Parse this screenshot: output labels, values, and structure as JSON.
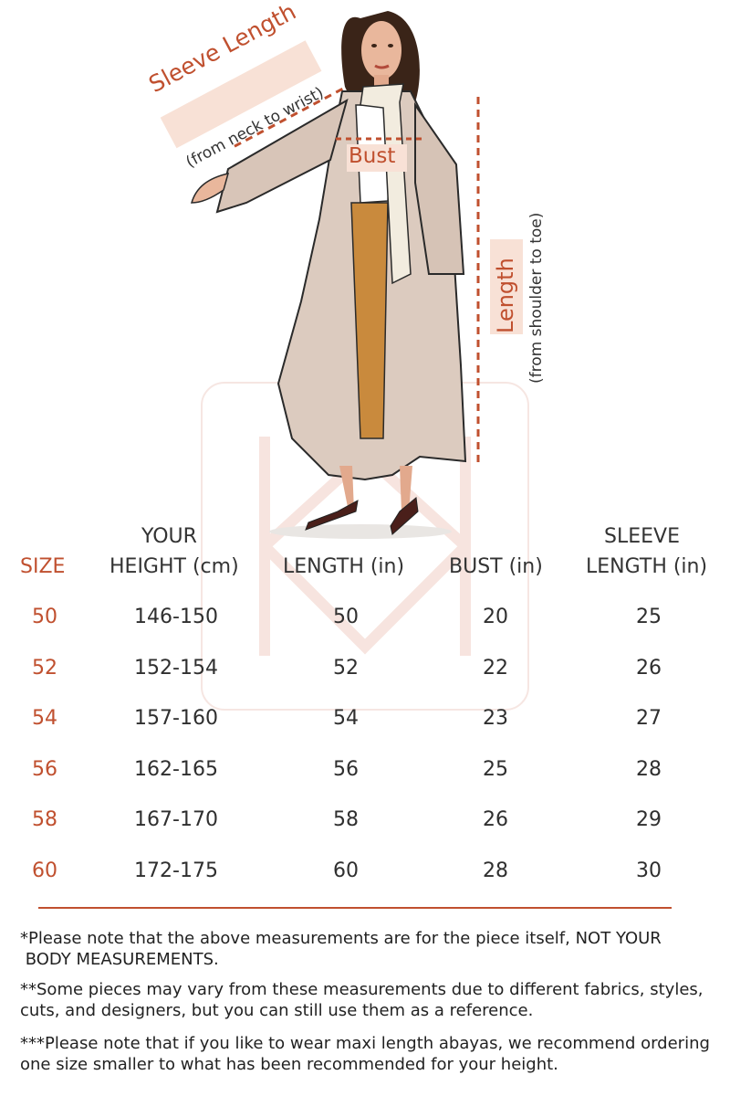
{
  "illustration": {
    "sleeve_label": "Sleeve Length",
    "sleeve_note": "(from neck to wrist)",
    "bust_label": "Bust",
    "length_label": "Length",
    "length_note": "(from shoulder to toe)",
    "accent": "#c0502f",
    "label_bg": "#f8e1d6"
  },
  "table": {
    "headers": {
      "size": "SIZE",
      "height_line1": "YOUR",
      "height_line2": "HEIGHT (cm)",
      "length": "LENGTH (in)",
      "bust": "BUST (in)",
      "sleeve_line1": "SLEEVE",
      "sleeve_line2": "LENGTH (in)"
    },
    "rows": [
      {
        "size": "50",
        "height": "146-150",
        "length": "50",
        "bust": "20",
        "sleeve": "25"
      },
      {
        "size": "52",
        "height": "152-154",
        "length": "52",
        "bust": "22",
        "sleeve": "26"
      },
      {
        "size": "54",
        "height": "157-160",
        "length": "54",
        "bust": "23",
        "sleeve": "27"
      },
      {
        "size": "56",
        "height": "162-165",
        "length": "56",
        "bust": "25",
        "sleeve": "28"
      },
      {
        "size": "58",
        "height": "167-170",
        "length": "58",
        "bust": "26",
        "sleeve": "29"
      },
      {
        "size": "60",
        "height": "172-175",
        "length": "60",
        "bust": "28",
        "sleeve": "30"
      }
    ]
  },
  "notes": {
    "note1_a": "*Please note that the above measurements are for the piece itself, NOT YOUR",
    "note1_b": " BODY MEASUREMENTS.",
    "note2": "**Some pieces may vary from these measurements due to different fabrics, styles, cuts, and designers, but you can still use them as a reference.",
    "note3": "***Please note that if you like to wear maxi length abayas, we recommend ordering one size smaller to what has been recommended for your height."
  }
}
